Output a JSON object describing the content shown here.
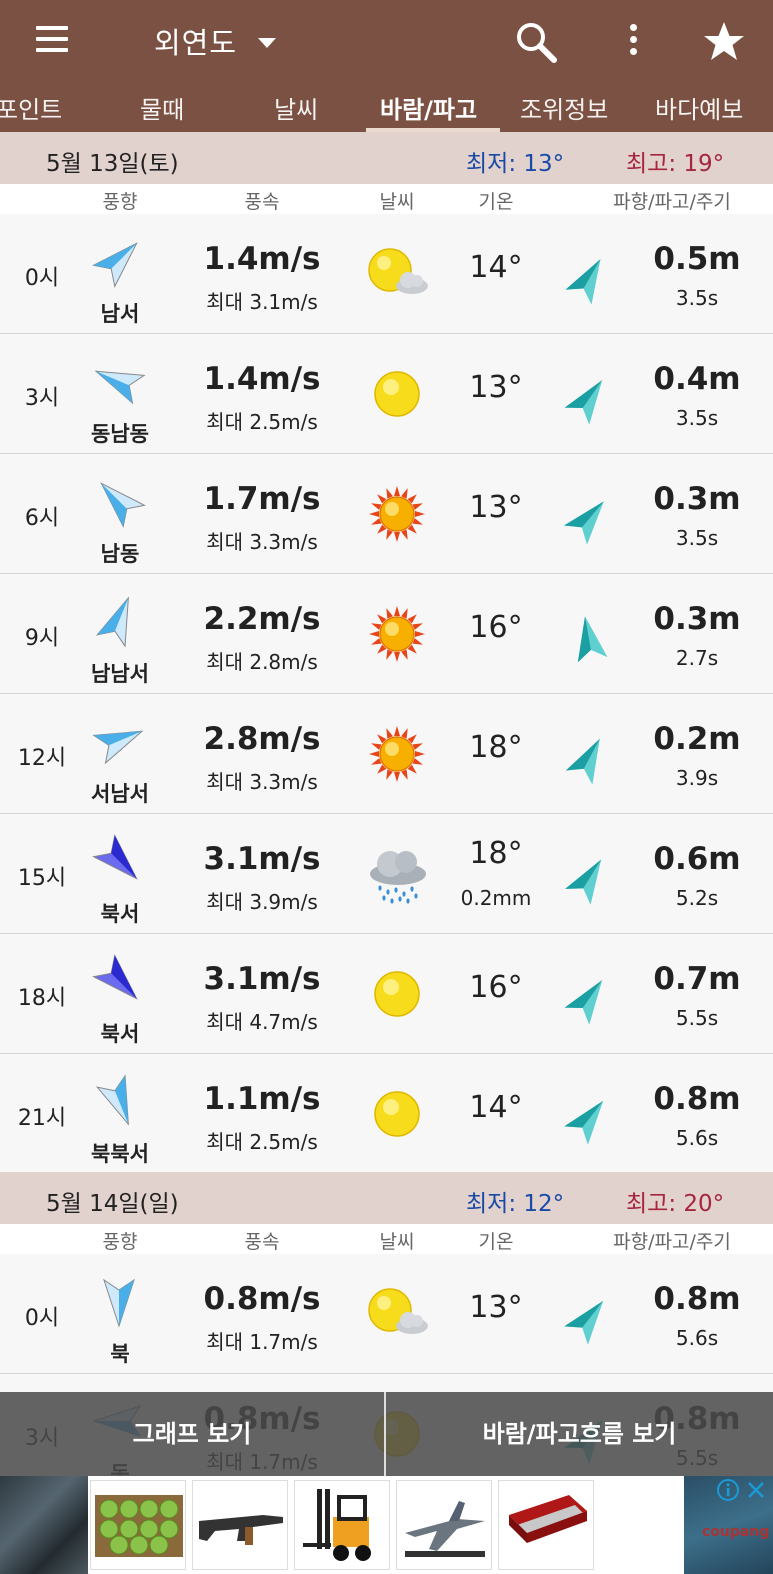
{
  "appbar": {
    "title": "외연도"
  },
  "tabs": [
    {
      "label": "포인트",
      "active": false
    },
    {
      "label": "물때",
      "active": false
    },
    {
      "label": "날씨",
      "active": false
    },
    {
      "label": "바람/파고",
      "active": true
    },
    {
      "label": "조위정보",
      "active": false
    },
    {
      "label": "바다예보",
      "active": false
    }
  ],
  "columns": {
    "wind_dir": "풍향",
    "wind_speed": "풍속",
    "weather": "날씨",
    "temp": "기온",
    "wave": "파향/파고/주기"
  },
  "days": [
    {
      "date": "5월 13일(토)",
      "min_label": "최저: 13°",
      "max_label": "최고: 19°",
      "rows": [
        {
          "hour": "0시",
          "wind_dir": "남서",
          "speed": "1.4m/s",
          "gust": "최대 3.1m/s",
          "weather_icon": "sun-cloud-icon",
          "temp": "14°",
          "rain": "",
          "wave": "0.5m",
          "period": "3.5s"
        },
        {
          "hour": "3시",
          "wind_dir": "동남동",
          "speed": "1.4m/s",
          "gust": "최대 2.5m/s",
          "weather_icon": "sun-icon",
          "temp": "13°",
          "rain": "",
          "wave": "0.4m",
          "period": "3.5s"
        },
        {
          "hour": "6시",
          "wind_dir": "남동",
          "speed": "1.7m/s",
          "gust": "최대 3.3m/s",
          "weather_icon": "sun-rays-icon",
          "temp": "13°",
          "rain": "",
          "wave": "0.3m",
          "period": "3.5s"
        },
        {
          "hour": "9시",
          "wind_dir": "남남서",
          "speed": "2.2m/s",
          "gust": "최대 2.8m/s",
          "weather_icon": "sun-rays-icon",
          "temp": "16°",
          "rain": "",
          "wave": "0.3m",
          "period": "2.7s"
        },
        {
          "hour": "12시",
          "wind_dir": "서남서",
          "speed": "2.8m/s",
          "gust": "최대 3.3m/s",
          "weather_icon": "sun-rays-icon",
          "temp": "18°",
          "rain": "",
          "wave": "0.2m",
          "period": "3.9s"
        },
        {
          "hour": "15시",
          "wind_dir": "북서",
          "speed": "3.1m/s",
          "gust": "최대 3.9m/s",
          "weather_icon": "rain-cloud-icon",
          "temp": "18°",
          "rain": "0.2mm",
          "wave": "0.6m",
          "period": "5.2s"
        },
        {
          "hour": "18시",
          "wind_dir": "북서",
          "speed": "3.1m/s",
          "gust": "최대 4.7m/s",
          "weather_icon": "sun-icon",
          "temp": "16°",
          "rain": "",
          "wave": "0.7m",
          "period": "5.5s"
        },
        {
          "hour": "21시",
          "wind_dir": "북북서",
          "speed": "1.1m/s",
          "gust": "최대 2.5m/s",
          "weather_icon": "sun-icon",
          "temp": "14°",
          "rain": "",
          "wave": "0.8m",
          "period": "5.6s"
        }
      ]
    },
    {
      "date": "5월 14일(일)",
      "min_label": "최저: 12°",
      "max_label": "최고: 20°",
      "rows": [
        {
          "hour": "0시",
          "wind_dir": "북",
          "speed": "0.8m/s",
          "gust": "최대 1.7m/s",
          "weather_icon": "sun-cloud-icon",
          "temp": "13°",
          "rain": "",
          "wave": "0.8m",
          "period": "5.6s"
        },
        {
          "hour": "3시",
          "wind_dir": "동",
          "speed": "0.8m/s",
          "gust": "최대 1.7m/s",
          "weather_icon": "sun-icon",
          "temp": "",
          "rain": "",
          "wave": "0.8m",
          "period": "5.5s"
        }
      ]
    }
  ],
  "bottom": {
    "graph_label": "그래프 보기",
    "flow_label": "바람/파고흐름 보기"
  },
  "ad": {
    "brand": "coupang",
    "products": [
      "green-apples-box",
      "toy-rifle",
      "forklift-model",
      "fighter-jet-model",
      "harmonica-case"
    ]
  }
}
